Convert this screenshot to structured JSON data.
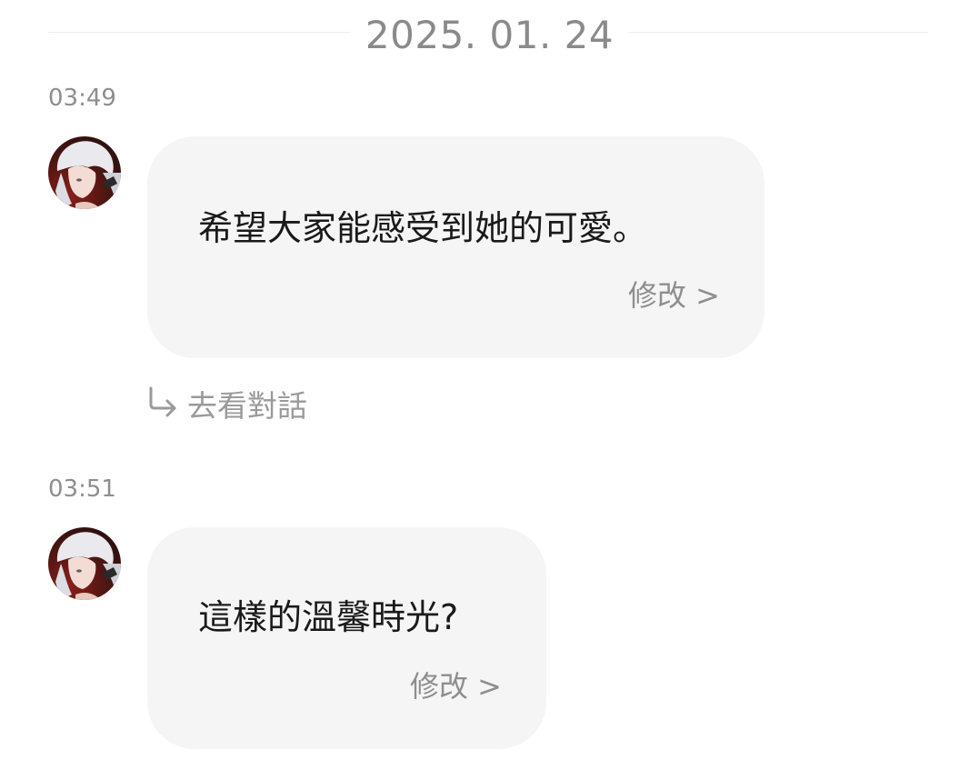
{
  "date_separator": "2025. 01. 24",
  "messages": [
    {
      "time": "03:49",
      "avatar_icon": "character-avatar-icon",
      "text": "希望大家能感受到她的可愛。",
      "edit_label": "修改 >"
    },
    {
      "time": "03:51",
      "avatar_icon": "character-avatar-icon",
      "text": "這樣的溫馨時光?",
      "edit_label": "修改 >"
    }
  ],
  "reply_link": {
    "icon": "reply-arrow-icon",
    "label": "去看對話"
  },
  "colors": {
    "bubble_bg": "#f5f5f5",
    "muted_text": "#8e8e8e",
    "message_text": "#1a1a1a"
  }
}
